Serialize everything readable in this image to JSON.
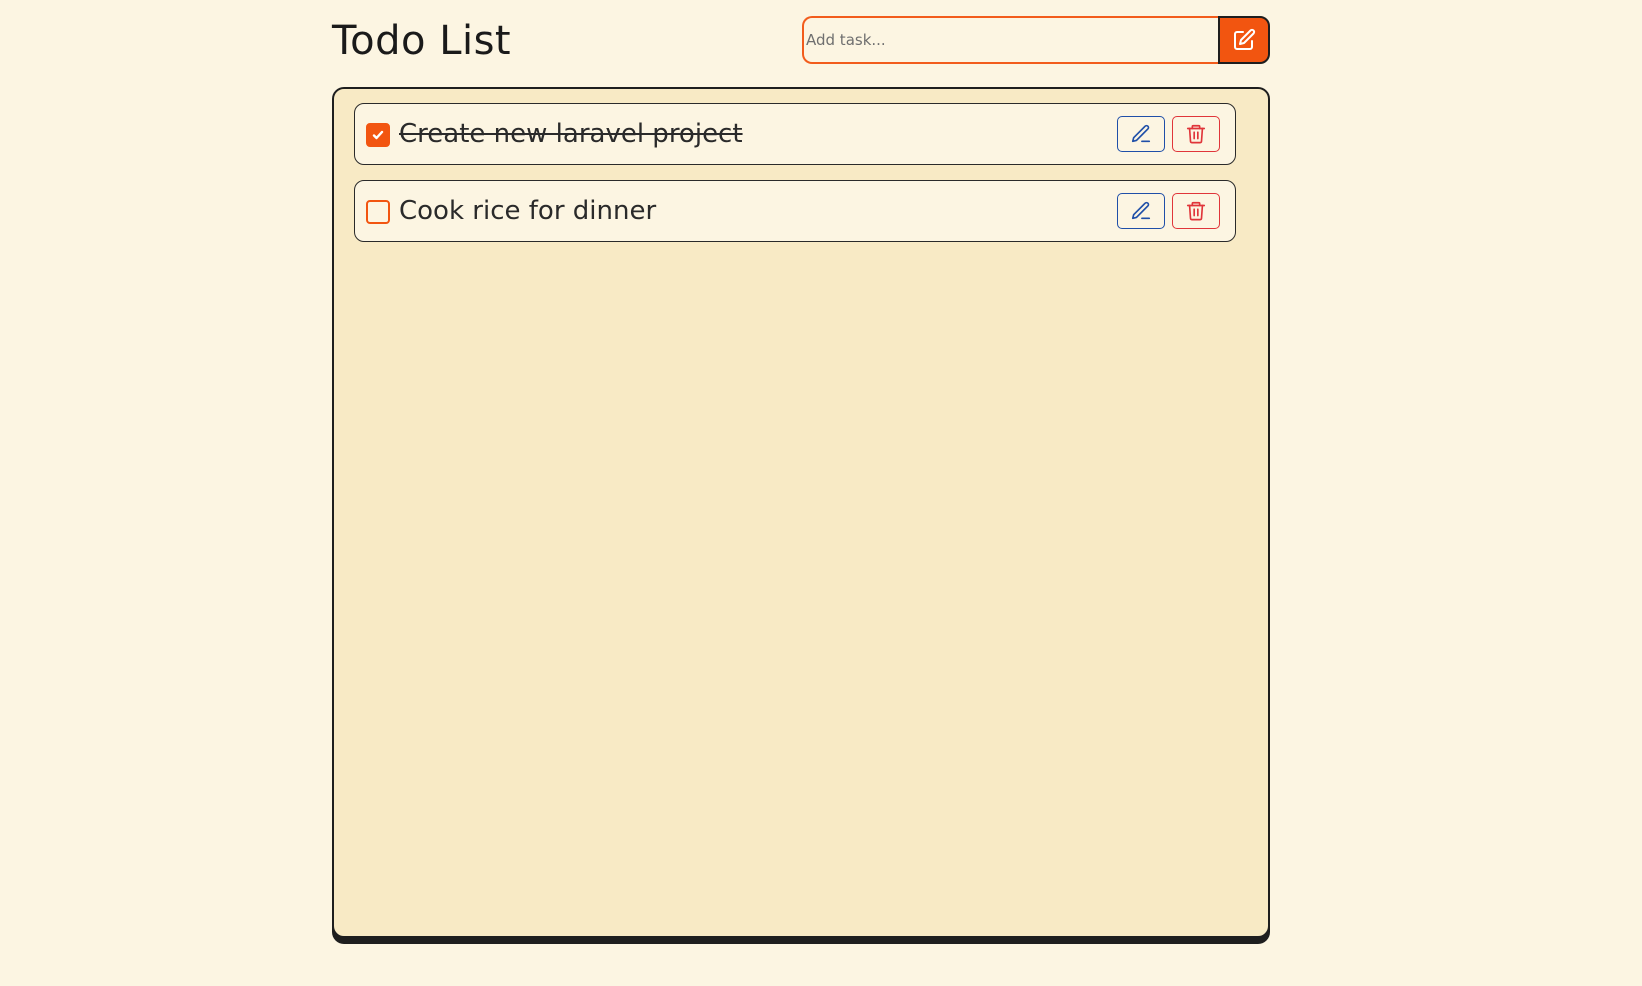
{
  "header": {
    "title": "Todo List"
  },
  "add_form": {
    "placeholder": "Add task...",
    "value": "",
    "button_icon": "edit-square-icon"
  },
  "tasks": [
    {
      "text": "Create new laravel project",
      "completed": true
    },
    {
      "text": "Cook rice for dinner",
      "completed": false
    }
  ],
  "task_actions": {
    "edit_icon": "pencil-icon",
    "delete_icon": "trash-icon"
  },
  "colors": {
    "background": "#fcf5e2",
    "panel": "#f8eac5",
    "accent": "#f25510",
    "edit": "#1f4fa8",
    "delete": "#e0353a",
    "border": "#1e1e1e"
  }
}
